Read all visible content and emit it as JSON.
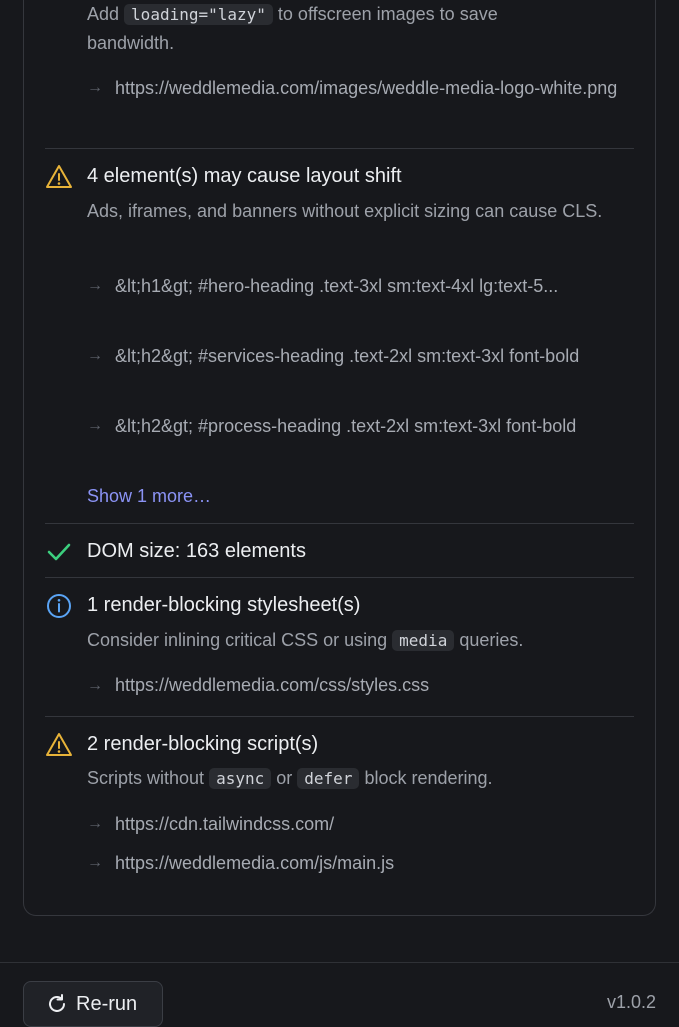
{
  "lazy": {
    "desc_pre": "Add",
    "desc_code": "loading=\"lazy\"",
    "desc_post": "to offscreen images to save",
    "desc_line2": "bandwidth.",
    "items": [
      "https://weddlemedia.com/images/weddle-media-logo-white.png"
    ]
  },
  "layout_shift": {
    "title": "4 element(s) may cause layout shift",
    "desc": "Ads, iframes, and banners without explicit sizing can cause CLS.",
    "items": [
      "&lt;h1&gt; #hero-heading .text-3xl sm:text-4xl lg:text-5...",
      "&lt;h2&gt; #services-heading .text-2xl sm:text-3xl font-bold",
      "&lt;h2&gt; #process-heading .text-2xl sm:text-3xl font-bold"
    ],
    "show_more": "Show 1 more…"
  },
  "dom_size": {
    "title": "DOM size: 163 elements"
  },
  "stylesheet": {
    "title": "1 render-blocking stylesheet(s)",
    "desc_pre": "Consider inlining critical CSS or using",
    "desc_code": "media",
    "desc_post": "queries.",
    "items": [
      "https://weddlemedia.com/css/styles.css"
    ]
  },
  "scripts": {
    "title": "2 render-blocking script(s)",
    "desc_pre": "Scripts without",
    "desc_code1": "async",
    "desc_mid": "or",
    "desc_code2": "defer",
    "desc_post": "block rendering.",
    "items": [
      "https://cdn.tailwindcss.com/",
      "https://weddlemedia.com/js/main.js"
    ]
  },
  "footer": {
    "rerun_label": "Re-run",
    "version": "v1.0.2"
  },
  "colors": {
    "warning": "#e8b339",
    "success": "#3ccf7e",
    "info": "#5aa4f5",
    "link": "#8b93f5"
  },
  "icons": [
    "warning-icon",
    "check-icon",
    "info-icon",
    "refresh-icon",
    "arrow-right-icon"
  ]
}
